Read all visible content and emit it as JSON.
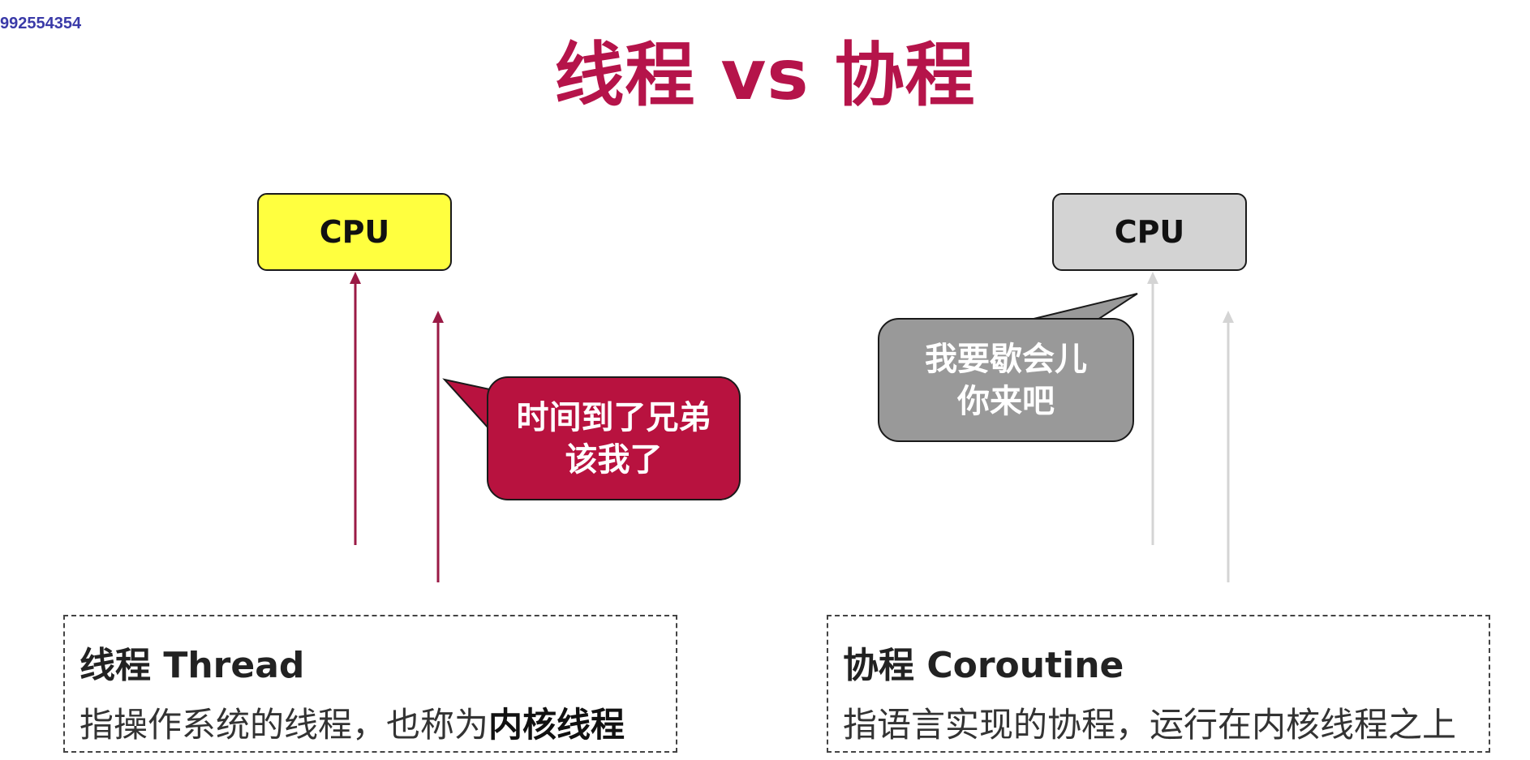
{
  "watermark": "992554354",
  "title": "线程 vs 协程",
  "left": {
    "cpu_label": "CPU",
    "bubble_line1": "时间到了兄弟",
    "bubble_line2": "该我了",
    "heading": "线程 Thread",
    "desc_prefix": "指操作系统的线程，也称为",
    "desc_bold": "内核线程"
  },
  "right": {
    "cpu_label": "CPU",
    "bubble_line1": "我要歇会儿",
    "bubble_line2": "你来吧",
    "heading": "协程 Coroutine",
    "desc": "指语言实现的协程，运行在内核线程之上"
  },
  "colors": {
    "accent": "#b5144a",
    "cpu_left": "#ffff3f",
    "cpu_right": "#d3d3d3",
    "bubble_left": "#b8123f",
    "bubble_right": "#999999",
    "arrow_left": "#9a1a45",
    "arrow_right": "#d4d4d4"
  }
}
